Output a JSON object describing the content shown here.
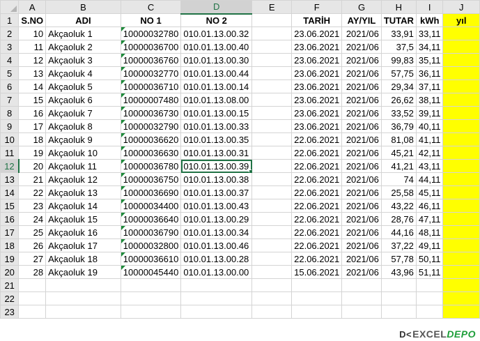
{
  "columns": [
    "A",
    "B",
    "C",
    "D",
    "E",
    "F",
    "G",
    "H",
    "I",
    "J"
  ],
  "selected_column": "D",
  "selected_row": 12,
  "headers": {
    "sno": "S.NO",
    "adi": "ADI",
    "no1": "NO 1",
    "no2": "NO 2",
    "e": "",
    "tarih": "TARİH",
    "ayyil": "AY/YIL",
    "tutar": "TUTAR",
    "kwh": "kWh",
    "yil": "yıl"
  },
  "rows": [
    {
      "row": "2",
      "sno": "10",
      "adi": "Akçaoluk 1",
      "no1": "10000032780",
      "no2": "010.01.13.00.32",
      "tarih": "23.06.2021",
      "ayyil": "2021/06",
      "tutar": "33,91",
      "kwh": "33,11"
    },
    {
      "row": "3",
      "sno": "11",
      "adi": "Akçaoluk 2",
      "no1": "10000036700",
      "no2": "010.01.13.00.40",
      "tarih": "23.06.2021",
      "ayyil": "2021/06",
      "tutar": "37,5",
      "kwh": "34,11"
    },
    {
      "row": "4",
      "sno": "12",
      "adi": "Akçaoluk 3",
      "no1": "10000036760",
      "no2": "010.01.13.00.30",
      "tarih": "23.06.2021",
      "ayyil": "2021/06",
      "tutar": "99,83",
      "kwh": "35,11"
    },
    {
      "row": "5",
      "sno": "13",
      "adi": "Akçaoluk 4",
      "no1": "10000032770",
      "no2": "010.01.13.00.44",
      "tarih": "23.06.2021",
      "ayyil": "2021/06",
      "tutar": "57,75",
      "kwh": "36,11"
    },
    {
      "row": "6",
      "sno": "14",
      "adi": "Akçaoluk 5",
      "no1": "10000036710",
      "no2": "010.01.13.00.14",
      "tarih": "23.06.2021",
      "ayyil": "2021/06",
      "tutar": "29,34",
      "kwh": "37,11"
    },
    {
      "row": "7",
      "sno": "15",
      "adi": "Akçaoluk 6",
      "no1": "10000007480",
      "no2": "010.01.13.08.00",
      "tarih": "23.06.2021",
      "ayyil": "2021/06",
      "tutar": "26,62",
      "kwh": "38,11"
    },
    {
      "row": "8",
      "sno": "16",
      "adi": "Akçaoluk 7",
      "no1": "10000036730",
      "no2": "010.01.13.00.15",
      "tarih": "23.06.2021",
      "ayyil": "2021/06",
      "tutar": "33,52",
      "kwh": "39,11"
    },
    {
      "row": "9",
      "sno": "17",
      "adi": "Akçaoluk 8",
      "no1": "10000032790",
      "no2": "010.01.13.00.33",
      "tarih": "23.06.2021",
      "ayyil": "2021/06",
      "tutar": "36,79",
      "kwh": "40,11"
    },
    {
      "row": "10",
      "sno": "18",
      "adi": "Akçaoluk 9",
      "no1": "10000036620",
      "no2": "010.01.13.00.35",
      "tarih": "22.06.2021",
      "ayyil": "2021/06",
      "tutar": "81,08",
      "kwh": "41,11"
    },
    {
      "row": "11",
      "sno": "19",
      "adi": "Akçaoluk 10",
      "no1": "10000036630",
      "no2": "010.01.13.00.31",
      "tarih": "22.06.2021",
      "ayyil": "2021/06",
      "tutar": "45,21",
      "kwh": "42,11"
    },
    {
      "row": "12",
      "sno": "20",
      "adi": "Akçaoluk 11",
      "no1": "10000036780",
      "no2": "010.01.13.00.39",
      "tarih": "22.06.2021",
      "ayyil": "2021/06",
      "tutar": "41,21",
      "kwh": "43,11"
    },
    {
      "row": "13",
      "sno": "21",
      "adi": "Akçaoluk 12",
      "no1": "10000036750",
      "no2": "010.01.13.00.38",
      "tarih": "22.06.2021",
      "ayyil": "2021/06",
      "tutar": "74",
      "kwh": "44,11"
    },
    {
      "row": "14",
      "sno": "22",
      "adi": "Akçaoluk 13",
      "no1": "10000036690",
      "no2": "010.01.13.00.37",
      "tarih": "22.06.2021",
      "ayyil": "2021/06",
      "tutar": "25,58",
      "kwh": "45,11"
    },
    {
      "row": "15",
      "sno": "23",
      "adi": "Akçaoluk 14",
      "no1": "10000034400",
      "no2": "010.01.13.00.43",
      "tarih": "22.06.2021",
      "ayyil": "2021/06",
      "tutar": "43,22",
      "kwh": "46,11"
    },
    {
      "row": "16",
      "sno": "24",
      "adi": "Akçaoluk 15",
      "no1": "10000036640",
      "no2": "010.01.13.00.29",
      "tarih": "22.06.2021",
      "ayyil": "2021/06",
      "tutar": "28,76",
      "kwh": "47,11"
    },
    {
      "row": "17",
      "sno": "25",
      "adi": "Akçaoluk 16",
      "no1": "10000036790",
      "no2": "010.01.13.00.34",
      "tarih": "22.06.2021",
      "ayyil": "2021/06",
      "tutar": "44,16",
      "kwh": "48,11"
    },
    {
      "row": "18",
      "sno": "26",
      "adi": "Akçaoluk 17",
      "no1": "10000032800",
      "no2": "010.01.13.00.46",
      "tarih": "22.06.2021",
      "ayyil": "2021/06",
      "tutar": "37,22",
      "kwh": "49,11"
    },
    {
      "row": "19",
      "sno": "27",
      "adi": "Akçaoluk 18",
      "no1": "10000036610",
      "no2": "010.01.13.00.28",
      "tarih": "22.06.2021",
      "ayyil": "2021/06",
      "tutar": "57,78",
      "kwh": "50,11"
    },
    {
      "row": "20",
      "sno": "28",
      "adi": "Akçaoluk 19",
      "no1": "10000045440",
      "no2": "010.01.13.00.00",
      "tarih": "15.06.2021",
      "ayyil": "2021/06",
      "tutar": "43,96",
      "kwh": "51,11"
    }
  ],
  "empty_rows": [
    "21",
    "22",
    "23"
  ],
  "header_row": "1",
  "colors": {
    "highlight": "#ffff00",
    "excel_green": "#217346",
    "header_gray": "#e6e6e6"
  },
  "logo": {
    "mark": "D<",
    "excel": "EXCEL",
    "depo": "DEPO"
  }
}
